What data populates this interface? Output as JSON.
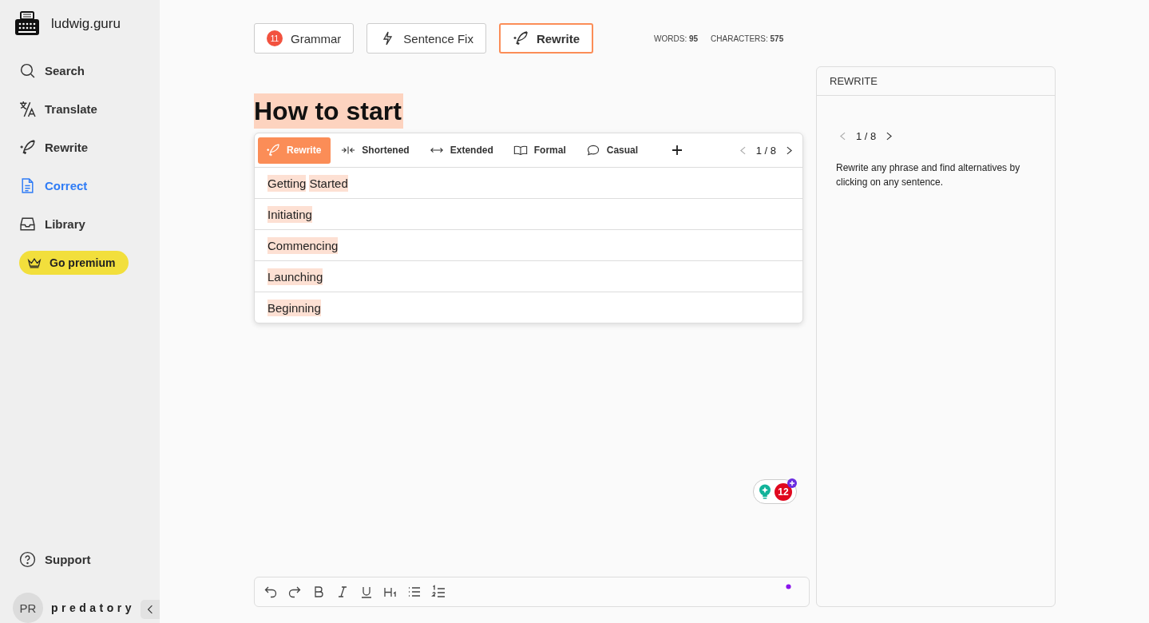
{
  "brand": {
    "name": "ludwig.guru"
  },
  "nav": [
    {
      "label": "Search",
      "selected": false
    },
    {
      "label": "Translate",
      "selected": false
    },
    {
      "label": "Rewrite",
      "selected": false
    },
    {
      "label": "Correct",
      "selected": true
    },
    {
      "label": "Library",
      "selected": false
    }
  ],
  "premium": {
    "label": "Go premium"
  },
  "support": {
    "label": "Support"
  },
  "user": {
    "initials": "PR",
    "name": "predatory"
  },
  "tools": [
    {
      "kind": "grammar",
      "label": "Grammar",
      "badge": "11",
      "selected": false
    },
    {
      "kind": "fix",
      "label": "Sentence Fix",
      "selected": false
    },
    {
      "kind": "rewrite",
      "label": "Rewrite",
      "selected": true
    }
  ],
  "stats": [
    {
      "label": "WORDS:",
      "value": "95"
    },
    {
      "label": "CHARACTERS:",
      "value": "575"
    }
  ],
  "document": {
    "title": "How to start"
  },
  "rewrite_popup": {
    "modes": [
      {
        "label": "Rewrite",
        "selected": true
      },
      {
        "label": "Shortened",
        "selected": false
      },
      {
        "label": "Extended",
        "selected": false
      },
      {
        "label": "Formal",
        "selected": false
      },
      {
        "label": "Casual",
        "selected": false
      }
    ],
    "pager": "1 / 8",
    "suggestions": [
      {
        "words": [
          "Getting",
          "Started"
        ]
      },
      {
        "words": [
          "Initiating"
        ]
      },
      {
        "words": [
          "Commencing"
        ]
      },
      {
        "words": [
          "Launching"
        ]
      },
      {
        "words": [
          "Beginning"
        ]
      }
    ]
  },
  "assistant": {
    "count": "12"
  },
  "panel": {
    "title": "REWRITE",
    "pager": "1 / 8",
    "hint": "Rewrite any phrase and find alternatives by clicking on any sentence."
  }
}
